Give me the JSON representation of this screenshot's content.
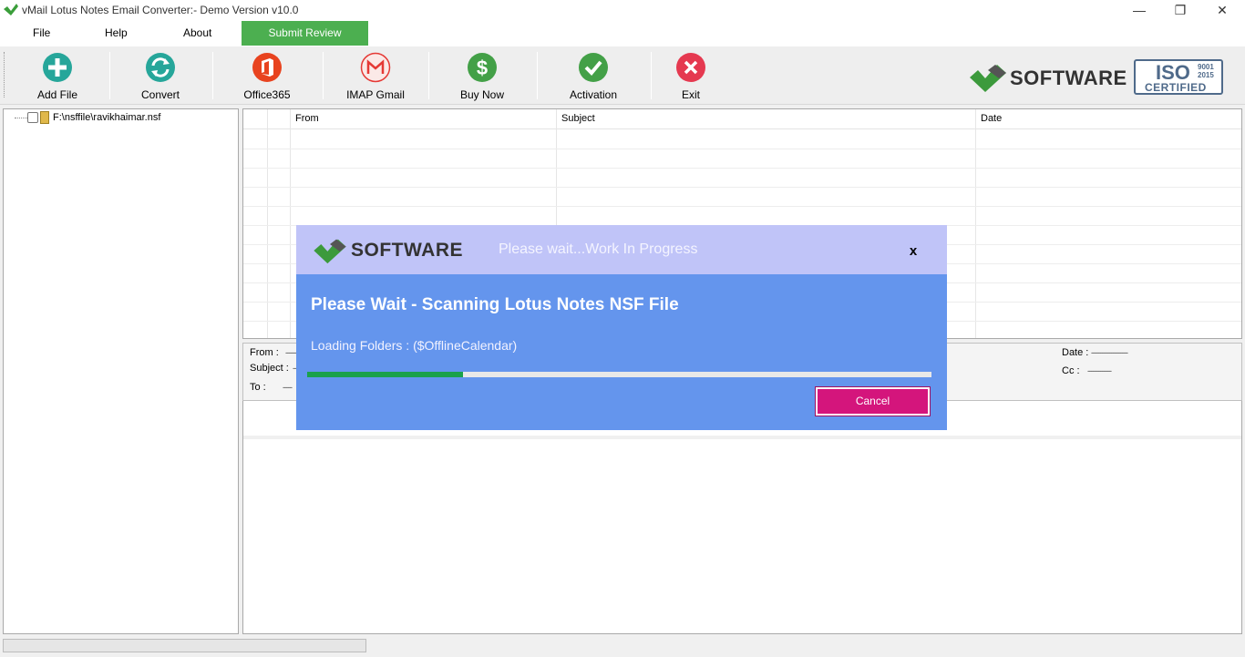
{
  "window": {
    "title": "vMail Lotus Notes Email Converter:- Demo Version v10.0",
    "controls": {
      "minimize": "—",
      "restore": "❐",
      "close": "✕"
    }
  },
  "menu": {
    "file": "File",
    "help": "Help",
    "about": "About",
    "submit_review": "Submit Review"
  },
  "toolbar": {
    "add_file": "Add File",
    "convert": "Convert",
    "office365": "Office365",
    "imap_gmail": "IMAP Gmail",
    "buy_now": "Buy Now",
    "activation": "Activation",
    "exit": "Exit"
  },
  "brand": {
    "name": "SOFTWARE",
    "iso_main": "ISO",
    "iso_line1": "9001",
    "iso_line2": "2015",
    "iso_certified": "CERTIFIED"
  },
  "tree": {
    "file_path": "F:\\nsffile\\ravikhaimar.nsf"
  },
  "grid": {
    "columns": {
      "from": "From",
      "subject": "Subject",
      "date": "Date"
    }
  },
  "details": {
    "from_label": "From :",
    "subject_label": "Subject :",
    "to_label": "To :",
    "date_label": "Date :",
    "cc_label": "Cc :",
    "from_value": "------",
    "subject_value": "--",
    "to_value": "-----",
    "date_value": "--------------------",
    "cc_value": "-------------"
  },
  "modal": {
    "brand": "SOFTWARE",
    "caption": "Please wait...Work In Progress",
    "close": "x",
    "title": "Please Wait - Scanning Lotus Notes NSF File",
    "status": "Loading Folders : ($OfflineCalendar)",
    "progress_fraction": 0.25,
    "cancel": "Cancel"
  },
  "colors": {
    "accent_green": "#4caf50",
    "modal_blue": "#6495ed",
    "modal_header": "#c0c4f8",
    "progress_green": "#1aa14b",
    "cancel_magenta": "#d4157c"
  }
}
